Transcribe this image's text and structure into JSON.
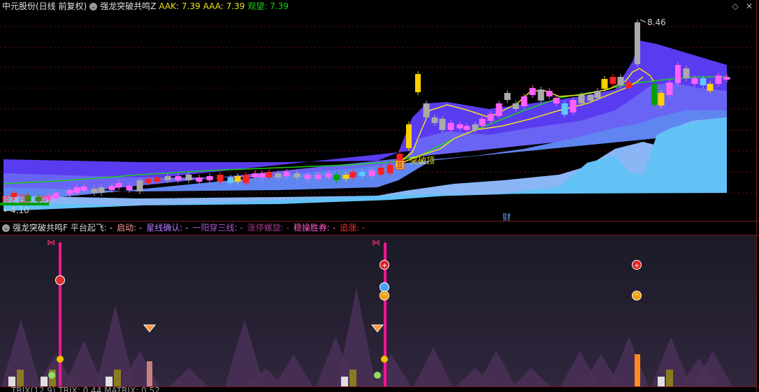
{
  "header": {
    "stock": "中元股份(日线 前复权)",
    "indicator": "强龙突破共鸣Z",
    "aak_label": "AAK: 7.39",
    "aaa_label": "AAA: 7.39",
    "watch_label": "观望: 7.39"
  },
  "price_chart": {
    "high_label": "8.46",
    "low_label": "←4.10",
    "breakout_label": "突破顶",
    "breakout_marker": "显",
    "buy_marks": [
      "中",
      "中",
      "中"
    ],
    "fin_marker": "财"
  },
  "sub_header": {
    "indicator": "强龙突破共鸣F",
    "items": [
      {
        "label": "平台起飞: -",
        "color": "#d0d0d0"
      },
      {
        "label": "启动: -",
        "color": "#ff9c9c"
      },
      {
        "label": "星线确认: -",
        "color": "#b47cff"
      },
      {
        "label": "一阳穿三线: -",
        "color": "#b058d8"
      },
      {
        "label": "涨停螺旋: -",
        "color": "#a03a8a"
      },
      {
        "label": "稳操胜券: -",
        "color": "#ff5ac8"
      },
      {
        "label": "追涨: -",
        "color": "#ff3030"
      }
    ]
  },
  "bottom": {
    "text": "TRIX(12,9) TRIX: 0.44 MATRIX: 0.52"
  },
  "colors": {
    "up": "#ff2d2d",
    "down": "#00c000",
    "ma_green": "#18d218",
    "ma_yellow": "#f0e020",
    "band_dark": "#4a3ad8",
    "band_light": "#60c8f8",
    "pink": "#ff1493"
  }
}
